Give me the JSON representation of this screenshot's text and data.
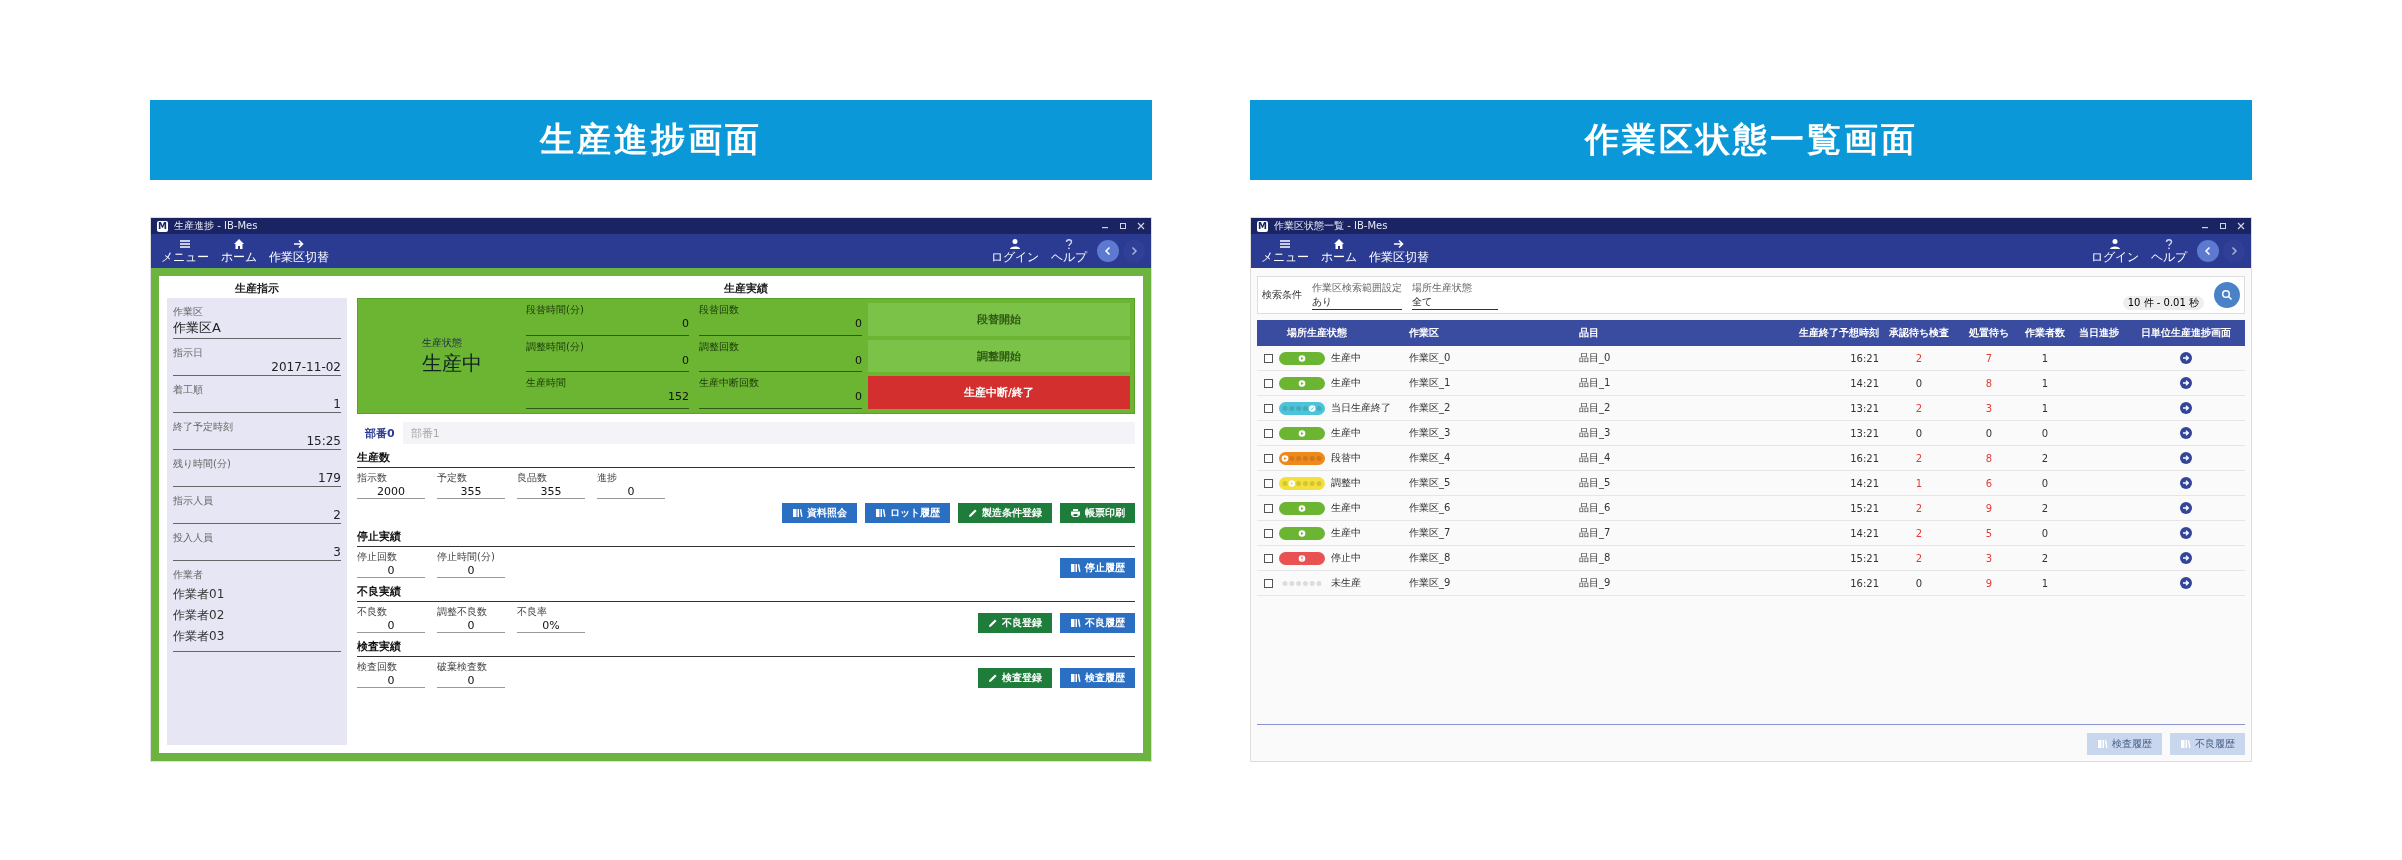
{
  "screens": [
    {
      "kind": "progress",
      "banner": "生産進捗画面",
      "app_icon": "M",
      "window": {
        "title": "生産進捗 - IB-Mes"
      },
      "toolbar": {
        "left": [
          {
            "kind": "menu",
            "label": "メニュー"
          },
          {
            "kind": "home",
            "label": "ホーム"
          },
          {
            "kind": "switch",
            "label": "作業区切替"
          }
        ],
        "right": [
          {
            "kind": "user",
            "label": "ログイン"
          },
          {
            "kind": "help",
            "label": "ヘルプ"
          }
        ],
        "nav": [
          {
            "kind": "back",
            "disabled": false
          },
          {
            "kind": "forward",
            "disabled": true
          }
        ]
      },
      "instruction": {
        "title": "生産指示",
        "work_area": {
          "label": "作業区",
          "value": "作業区A"
        },
        "fields": [
          {
            "label": "指示日",
            "value": "2017-11-02"
          },
          {
            "label": "着工順",
            "value": "1"
          },
          {
            "label": "終了予定時刻",
            "value": "15:25"
          },
          {
            "label": "残り時間(分)",
            "value": "179"
          },
          {
            "label": "指示人員",
            "value": "2"
          },
          {
            "label": "投入人員",
            "value": "3"
          }
        ],
        "workers": {
          "label": "作業者",
          "names": [
            "作業者01",
            "作業者02",
            "作業者03"
          ]
        }
      },
      "results": {
        "title": "生産実績",
        "status": {
          "label": "生産状態",
          "value": "生産中"
        },
        "counters": [
          {
            "label": "段替時間(分)",
            "value": "0"
          },
          {
            "label": "段替回数",
            "value": "0"
          },
          {
            "label": "調整時間(分)",
            "value": "0"
          },
          {
            "label": "調整回数",
            "value": "0"
          },
          {
            "label": "生産時間",
            "value": "152"
          },
          {
            "label": "生産中断回数",
            "value": "0"
          }
        ],
        "actions": [
          {
            "label": "段替開始",
            "kind": "start",
            "disabled": true
          },
          {
            "label": "調整開始",
            "kind": "start",
            "disabled": true
          },
          {
            "label": "生産中断/終了",
            "kind": "stop",
            "disabled": false
          }
        ]
      },
      "tabs": [
        {
          "label": "部番0",
          "selected": true
        },
        {
          "label": "部番1",
          "selected": false
        }
      ],
      "sections": [
        {
          "title": "生産数",
          "kind": "stacked",
          "fields": [
            {
              "label": "指示数",
              "value": "2000"
            },
            {
              "label": "予定数",
              "value": "355"
            },
            {
              "label": "良品数",
              "value": "355"
            },
            {
              "label": "進捗",
              "value": "0"
            }
          ],
          "buttons": [
            {
              "label": "資料照会",
              "kind": "book"
            },
            {
              "label": "ロット履歴",
              "kind": "book"
            },
            {
              "label": "製造条件登録",
              "kind": "pencil"
            },
            {
              "label": "帳票印刷",
              "kind": "printer"
            }
          ]
        },
        {
          "title": "停止実績",
          "kind": "inline",
          "fields": [
            {
              "label": "停止回数",
              "value": "0"
            },
            {
              "label": "停止時間(分)",
              "value": "0"
            }
          ],
          "buttons": [
            {
              "label": "停止履歴",
              "kind": "book"
            }
          ]
        },
        {
          "title": "不良実績",
          "kind": "inline",
          "fields": [
            {
              "label": "不良数",
              "value": "0"
            },
            {
              "label": "調整不良数",
              "value": "0"
            },
            {
              "label": "不良率",
              "value": "0%"
            }
          ],
          "buttons": [
            {
              "label": "不良登録",
              "kind": "pencil"
            },
            {
              "label": "不良履歴",
              "kind": "book"
            }
          ]
        },
        {
          "title": "検査実績",
          "kind": "inline",
          "fields": [
            {
              "label": "検査回数",
              "value": "0"
            },
            {
              "label": "破棄検査数",
              "value": "0"
            }
          ],
          "buttons": [
            {
              "label": "検査登録",
              "kind": "pencil"
            },
            {
              "label": "検査履歴",
              "kind": "book"
            }
          ]
        }
      ]
    },
    {
      "kind": "status_list",
      "banner": "作業区状態一覧画面",
      "app_icon": "M",
      "window": {
        "title": "作業区状態一覧 - IB-Mes"
      },
      "toolbar": {
        "left": [
          {
            "kind": "menu",
            "label": "メニュー"
          },
          {
            "kind": "home",
            "label": "ホーム"
          },
          {
            "kind": "switch",
            "label": "作業区切替"
          }
        ],
        "right": [
          {
            "kind": "user",
            "label": "ログイン"
          },
          {
            "kind": "help",
            "label": "ヘルプ"
          }
        ],
        "nav": [
          {
            "kind": "back",
            "disabled": false
          },
          {
            "kind": "forward",
            "disabled": true
          }
        ]
      },
      "search": {
        "label": "検索条件",
        "filters": [
          {
            "label": "作業区検索範囲設定",
            "value": "あり"
          },
          {
            "label": "場所生産状態",
            "value": "全て"
          }
        ],
        "result_count": "10 件 - 0.01 秒"
      },
      "table": {
        "columns": [
          "場所生産状態",
          "作業区",
          "品目",
          "生産終了予想時刻",
          "承認待ち検査",
          "処置待ち",
          "作業者数",
          "当日進捗",
          "日単位生産進捗画面"
        ],
        "rows": [
          {
            "checked": false,
            "status": {
              "kind": "running",
              "color": "#6cb532",
              "text": "生産中"
            },
            "area": "作業区_0",
            "item": "品目_0",
            "end_time": "16:21",
            "approval": {
              "text": "2",
              "alert": true
            },
            "pending": {
              "text": "7",
              "alert": true
            },
            "workers": "1"
          },
          {
            "checked": false,
            "status": {
              "kind": "running",
              "color": "#6cb532",
              "text": "生産中"
            },
            "area": "作業区_1",
            "item": "品目_1",
            "end_time": "14:21",
            "approval": {
              "text": "0",
              "alert": false
            },
            "pending": {
              "text": "8",
              "alert": true
            },
            "workers": "1"
          },
          {
            "checked": false,
            "status": {
              "kind": "done",
              "color": "#4cc3d9",
              "text": "当日生産終了"
            },
            "area": "作業区_2",
            "item": "品目_2",
            "end_time": "13:21",
            "approval": {
              "text": "2",
              "alert": true
            },
            "pending": {
              "text": "3",
              "alert": true
            },
            "workers": "1"
          },
          {
            "checked": false,
            "status": {
              "kind": "running",
              "color": "#6cb532",
              "text": "生産中"
            },
            "area": "作業区_3",
            "item": "品目_3",
            "end_time": "13:21",
            "approval": {
              "text": "0",
              "alert": false
            },
            "pending": {
              "text": "0",
              "alert": false
            },
            "workers": "0"
          },
          {
            "checked": false,
            "status": {
              "kind": "changeover",
              "color": "#ee8a1c",
              "text": "段替中"
            },
            "area": "作業区_4",
            "item": "品目_4",
            "end_time": "16:21",
            "approval": {
              "text": "2",
              "alert": true
            },
            "pending": {
              "text": "8",
              "alert": true
            },
            "workers": "2"
          },
          {
            "checked": false,
            "status": {
              "kind": "adjusting",
              "color": "#f2e03c",
              "text": "調整中"
            },
            "area": "作業区_5",
            "item": "品目_5",
            "end_time": "14:21",
            "approval": {
              "text": "1",
              "alert": true
            },
            "pending": {
              "text": "6",
              "alert": true
            },
            "workers": "0"
          },
          {
            "checked": false,
            "status": {
              "kind": "running",
              "color": "#6cb532",
              "text": "生産中"
            },
            "area": "作業区_6",
            "item": "品目_6",
            "end_time": "15:21",
            "approval": {
              "text": "2",
              "alert": true
            },
            "pending": {
              "text": "9",
              "alert": true
            },
            "workers": "2"
          },
          {
            "checked": false,
            "status": {
              "kind": "running",
              "color": "#6cb532",
              "text": "生産中"
            },
            "area": "作業区_7",
            "item": "品目_7",
            "end_time": "14:21",
            "approval": {
              "text": "2",
              "alert": true
            },
            "pending": {
              "text": "5",
              "alert": true
            },
            "workers": "0"
          },
          {
            "checked": false,
            "status": {
              "kind": "stopped",
              "color": "#e85252",
              "text": "停止中"
            },
            "area": "作業区_8",
            "item": "品目_8",
            "end_time": "15:21",
            "approval": {
              "text": "2",
              "alert": true
            },
            "pending": {
              "text": "3",
              "alert": true
            },
            "workers": "2"
          },
          {
            "checked": false,
            "status": {
              "kind": "idle",
              "color": "#dddddd",
              "text": "未生産"
            },
            "area": "作業区_9",
            "item": "品目_9",
            "end_time": "16:21",
            "approval": {
              "text": "0",
              "alert": false
            },
            "pending": {
              "text": "9",
              "alert": true
            },
            "workers": "1"
          }
        ]
      },
      "footer_buttons": [
        {
          "label": "検査履歴",
          "disabled": true
        },
        {
          "label": "不良履歴",
          "disabled": true
        }
      ]
    }
  ]
}
